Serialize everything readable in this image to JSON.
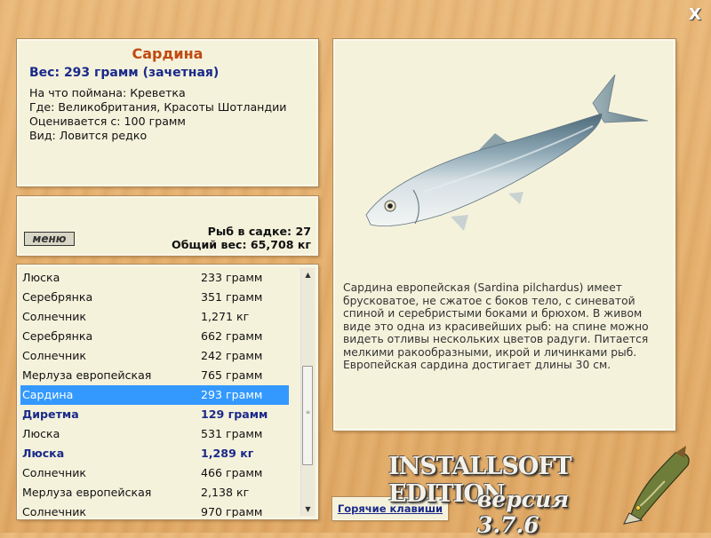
{
  "info": {
    "title": "Сардина",
    "weight": "Вес: 293 грамм (зачетная)",
    "lines": [
      "На что поймана: Креветка",
      "Где: Великобритания, Красоты Шотландии",
      "Оценивается с: 100 грамм",
      "Вид: Ловится редко"
    ]
  },
  "stats": {
    "menu_label": "меню",
    "fish_count": "Рыб в садке: 27",
    "total_weight": "Общий вес: 65,708 кг"
  },
  "list": {
    "selected_index": 6,
    "scroll_position_fraction": 0.45,
    "rows": [
      {
        "name": "Люска",
        "weight": "233 грамм"
      },
      {
        "name": "Серебрянка",
        "weight": "351 грамм"
      },
      {
        "name": "Солнечник",
        "weight": "1,271 кг"
      },
      {
        "name": "Серебрянка",
        "weight": "662 грамм"
      },
      {
        "name": "Солнечник",
        "weight": "242 грамм"
      },
      {
        "name": "Мерлуза европейская",
        "weight": "765 грамм"
      },
      {
        "name": "Сардина",
        "weight": "293 грамм"
      },
      {
        "name": "Диретма",
        "weight": "129 грамм"
      },
      {
        "name": "Люска",
        "weight": "531 грамм"
      },
      {
        "name": "Люска",
        "weight": "1,289 кг"
      },
      {
        "name": "Солнечник",
        "weight": "466 грамм"
      },
      {
        "name": "Мерлуза европейская",
        "weight": "2,138 кг"
      },
      {
        "name": "Солнечник",
        "weight": "970 грамм"
      }
    ]
  },
  "description": "Сардина европейская (Sardina pilchardus) имеет брусковатое, не сжатое с боков тело, с синеватой спиной и серебристыми боками и брюхом. В живом виде это одна из красивейших рыб: на спине можно видеть отливы нескольких цветов радуги. Питается мелкими ракообразными, икрой и личинками рыб. Европейская сардина достигает длины 30 см.",
  "hotkeys_label": "Горячие клавиши",
  "logo": {
    "line1": "INSTALLSOFT EDITION",
    "line2": "версия 3.7.6"
  },
  "close_label": "X",
  "colors": {
    "title": "#c04a10",
    "accent": "#1a2a8a",
    "selection": "#3399ff",
    "panel": "#f5f2dc"
  },
  "icons": {
    "close": "close-icon",
    "fish": "sardine-illustration",
    "logo_fish": "pike-fish-icon"
  }
}
